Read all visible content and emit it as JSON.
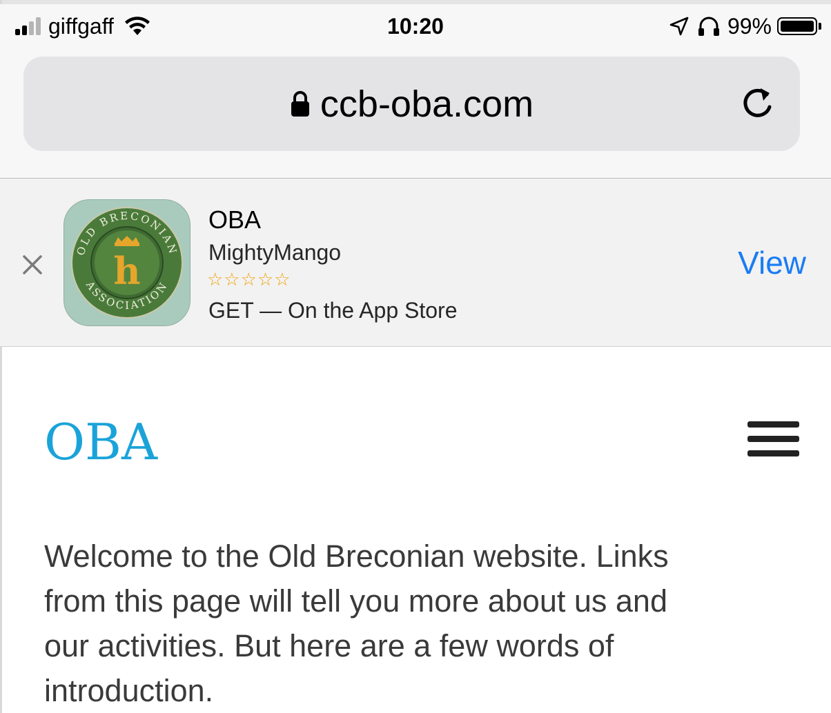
{
  "status_bar": {
    "carrier": "giffgaff",
    "time": "10:20",
    "battery": "99%",
    "battery_level": 0.99,
    "icons": [
      "signal-bars-icon",
      "wifi-icon",
      "location-arrow-icon",
      "headphones-icon",
      "battery-icon"
    ]
  },
  "browser": {
    "url": "ccb-oba.com",
    "secure_icon": "lock-icon",
    "reload_icon": "reload-icon"
  },
  "app_banner": {
    "name": "OBA",
    "developer": "MightyMango",
    "stars": "☆☆☆☆☆",
    "rating_stars_filled": 0,
    "store_text": "GET — On the App Store",
    "view_label": "View",
    "close_icon": "close-icon",
    "logo_text": "OLD BRECONIAN ASSOCIATION",
    "logo_letter": "h"
  },
  "page": {
    "site_title": "OBA",
    "menu_icon": "hamburger-menu-icon",
    "intro_lines": [
      "Welcome to the Old Breconian website. Links",
      "from this page will tell you more about us and",
      "our activities. But here are a few words of",
      "introduction."
    ]
  },
  "colors": {
    "site_title": "#1aa3d9",
    "view_link": "#1a7cf5",
    "stars": "#f0a30a",
    "status_bar_bg": "#f7f7f7",
    "banner_bg": "#f2f2f2",
    "address_bar_bg": "#e4e4e7"
  }
}
